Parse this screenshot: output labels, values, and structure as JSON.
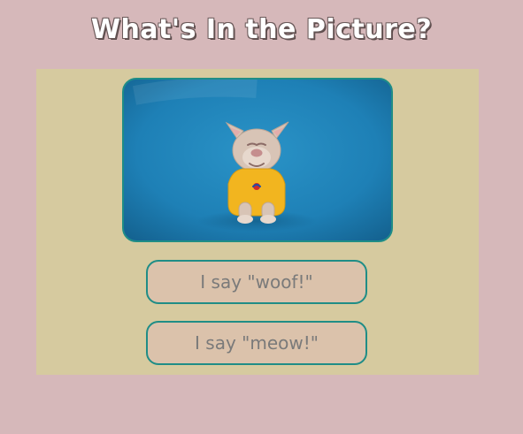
{
  "page": {
    "title": "What's In the Picture?"
  },
  "colors": {
    "background": "#d6b8ba",
    "panel": "#d6ca9f",
    "accent": "#1f8d86",
    "button_fill": "#dbc2ab",
    "button_text": "#7a7a7a",
    "photo_background": "#1e80b6"
  },
  "picture": {
    "description_icon": "dog-photo"
  },
  "answers": [
    {
      "label": "I say \"woof!\""
    },
    {
      "label": "I say \"meow!\""
    }
  ]
}
